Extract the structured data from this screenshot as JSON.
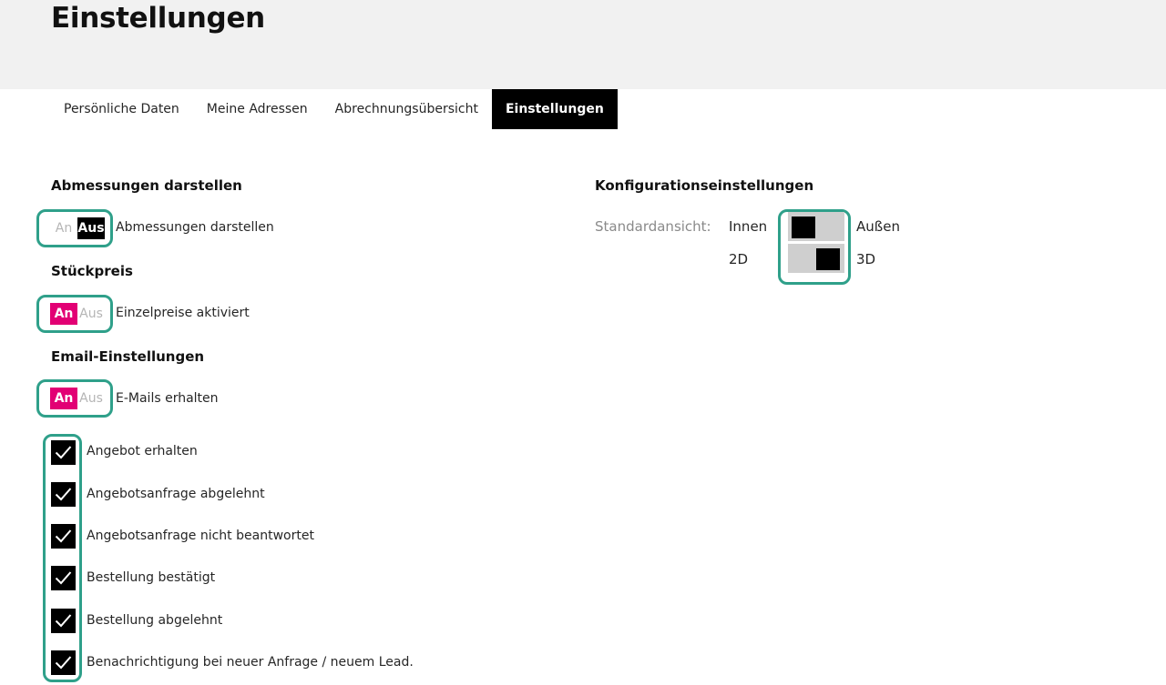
{
  "page": {
    "title": "Einstellungen"
  },
  "tabs": [
    {
      "label": "Persönliche Daten"
    },
    {
      "label": "Meine Adressen"
    },
    {
      "label": "Abrechnungsübersicht"
    },
    {
      "label": "Einstellungen",
      "active": true
    }
  ],
  "dimensions": {
    "title": "Abmessungen darstellen",
    "toggle": {
      "on": "An",
      "off": "Aus",
      "value": "Aus"
    },
    "label": "Abmessungen darstellen"
  },
  "unit_price": {
    "title": "Stückpreis",
    "toggle": {
      "on": "An",
      "off": "Aus",
      "value": "An"
    },
    "label": "Einzelpreise aktiviert"
  },
  "email": {
    "title": "Email-Einstellungen",
    "toggle": {
      "on": "An",
      "off": "Aus",
      "value": "An"
    },
    "label": "E-Mails erhalten",
    "options": [
      {
        "label": "Angebot erhalten",
        "checked": true
      },
      {
        "label": "Angebotsanfrage abgelehnt",
        "checked": true
      },
      {
        "label": "Angebotsanfrage nicht beantwortet",
        "checked": true
      },
      {
        "label": "Bestellung bestätigt",
        "checked": true
      },
      {
        "label": "Bestellung abgelehnt",
        "checked": true
      },
      {
        "label": "Benachrichtigung bei neuer Anfrage / neuem Lead.",
        "checked": true
      }
    ]
  },
  "config": {
    "title": "Konfigurationseinstellungen",
    "standard_label": "Standardansicht:",
    "view_switch": {
      "left": "Innen",
      "right": "Außen",
      "value": "Innen"
    },
    "dim_switch": {
      "left": "2D",
      "right": "3D",
      "value": "3D"
    }
  },
  "colors": {
    "accent": "#e20074",
    "highlight": "#2fa08a",
    "header_bg": "#f1f1f1"
  }
}
